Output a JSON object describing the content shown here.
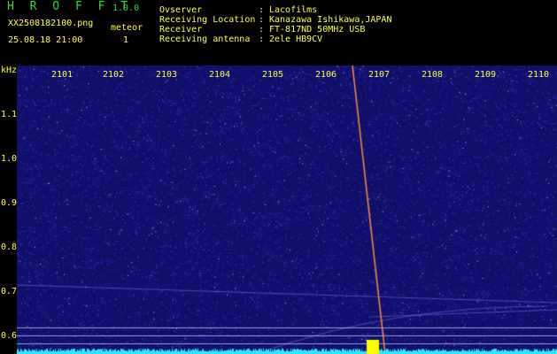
{
  "app": {
    "logo": "HROFFT",
    "version": "1.0.0",
    "filename": "XX2508182100.png",
    "meteor_label": "meteor",
    "datetime": "25.08.18 21:00",
    "meteor_count": "1"
  },
  "station": [
    {
      "label": "Ovserver",
      "sep": ":",
      "value": "Lacofilms"
    },
    {
      "label": "Receiving Location",
      "sep": ":",
      "value": "Kanazawa Ishikawa,JAPAN"
    },
    {
      "label": "Receiver",
      "sep": ":",
      "value": "FT-817ND 50MHz USB"
    },
    {
      "label": "Receiving antenna",
      "sep": ":",
      "value": "2ele HB9CV"
    }
  ],
  "axes": {
    "y_unit": "kHz",
    "y_ticks": [
      "1.1",
      "1.0",
      "0.9",
      "0.8",
      "0.7",
      "0.6"
    ],
    "x_ticks": [
      "2101",
      "2102",
      "2103",
      "2104",
      "2105",
      "2106",
      "2107",
      "2108",
      "2109",
      "2110"
    ]
  },
  "colors": {
    "background": "#000000",
    "waterfall": "#10106a",
    "noise": "#3c3cff",
    "label": "#ffff40",
    "title": "#37d53a",
    "meteor_trace": "#ff8a3a",
    "baseline": "#2ee6ff",
    "burst": "#ffff00"
  }
}
